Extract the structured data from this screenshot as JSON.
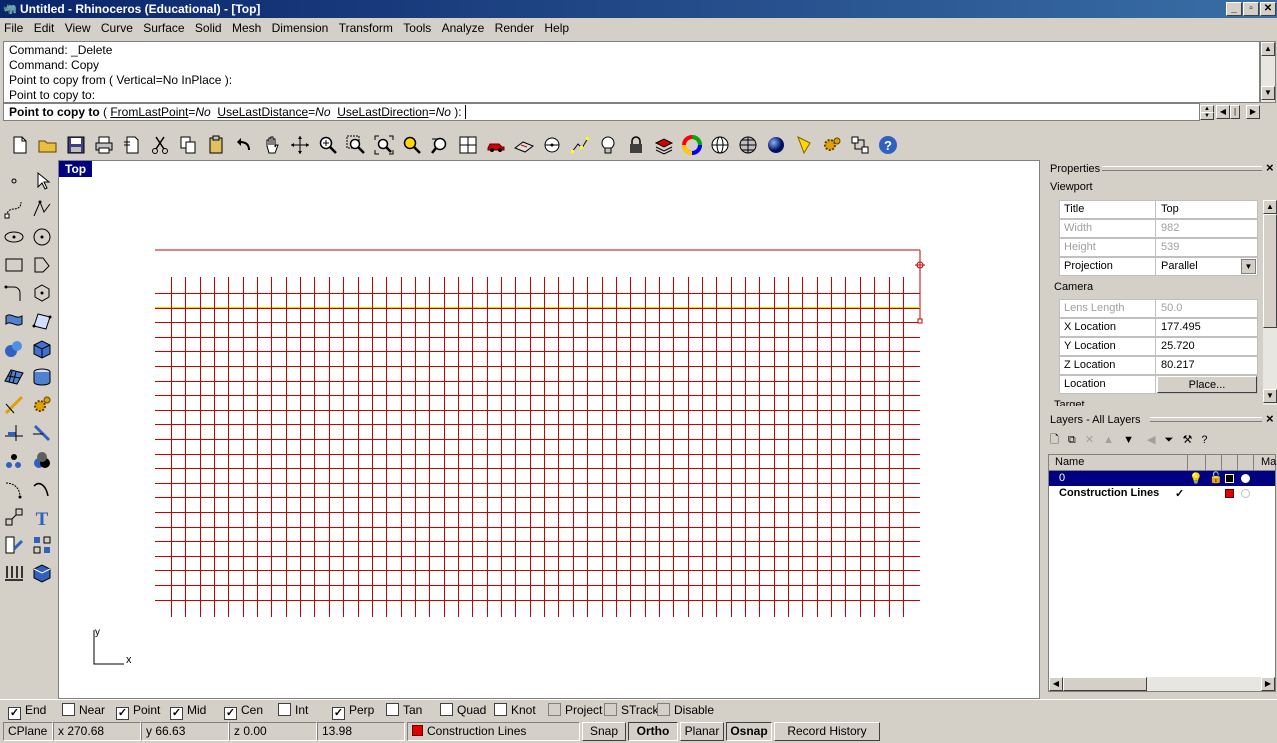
{
  "window": {
    "title": "Untitled - Rhinoceros (Educational) - [Top]"
  },
  "menu": [
    "File",
    "Edit",
    "View",
    "Curve",
    "Surface",
    "Solid",
    "Mesh",
    "Dimension",
    "Transform",
    "Tools",
    "Analyze",
    "Render",
    "Help"
  ],
  "command": {
    "history": [
      "Command: _Delete",
      "Command: Copy",
      "Point to copy from ( Vertical=No  InPlace ):",
      "Point to copy to:"
    ],
    "prompt_label": "Point to copy to",
    "opt1": "FromLastPoint",
    "val1": "No",
    "opt2": "UseLastDistance",
    "val2": "No",
    "opt3": "UseLastDirection",
    "val3": "No"
  },
  "viewport": {
    "title": "Top",
    "axis_x": "x",
    "axis_y": "y"
  },
  "properties": {
    "panel_title": "Properties",
    "section": "Viewport",
    "title_k": "Title",
    "title_v": "Top",
    "width_k": "Width",
    "width_v": "982",
    "height_k": "Height",
    "height_v": "539",
    "projection_k": "Projection",
    "projection_v": "Parallel",
    "camera": "Camera",
    "lens_k": "Lens Length",
    "lens_v": "50.0",
    "xloc_k": "X Location",
    "xloc_v": "177.495",
    "yloc_k": "Y Location",
    "yloc_v": "25.720",
    "zloc_k": "Z Location",
    "zloc_v": "80.217",
    "loc_k": "Location",
    "place_btn": "Place...",
    "target": "Target"
  },
  "layers": {
    "panel_title": "Layers - All Layers",
    "col_name": "Name",
    "col_mat": "Ma",
    "rows": [
      {
        "name": "0",
        "current": "",
        "color": "#000000"
      },
      {
        "name": "Construction Lines",
        "current": "✓",
        "color": "#e00000"
      }
    ]
  },
  "osnaps": [
    {
      "label": "End",
      "checked": "✓"
    },
    {
      "label": "Near",
      "checked": ""
    },
    {
      "label": "Point",
      "checked": "✓"
    },
    {
      "label": "Mid",
      "checked": "✓"
    },
    {
      "label": "Cen",
      "checked": "✓"
    },
    {
      "label": "Int",
      "checked": ""
    },
    {
      "label": "Perp",
      "checked": "✓"
    },
    {
      "label": "Tan",
      "checked": ""
    },
    {
      "label": "Quad",
      "checked": ""
    },
    {
      "label": "Knot",
      "checked": ""
    },
    {
      "label": "Project",
      "checked": ""
    },
    {
      "label": "STrack",
      "checked": ""
    },
    {
      "label": "Disable",
      "checked": ""
    }
  ],
  "status": {
    "cplane": "CPlane",
    "x": "x 270.68",
    "y": "y 66.63",
    "z": "z 0.00",
    "dist": "13.98",
    "layer": "Construction Lines",
    "layer_color": "#e00000",
    "snap": "Snap",
    "ortho": "Ortho",
    "planar": "Planar",
    "osnap": "Osnap",
    "history": "Record History"
  },
  "colors": {
    "grid": "#cc0000",
    "highlight": "#e0e000",
    "title_bar": "#0a246a",
    "selection": "#000080"
  }
}
